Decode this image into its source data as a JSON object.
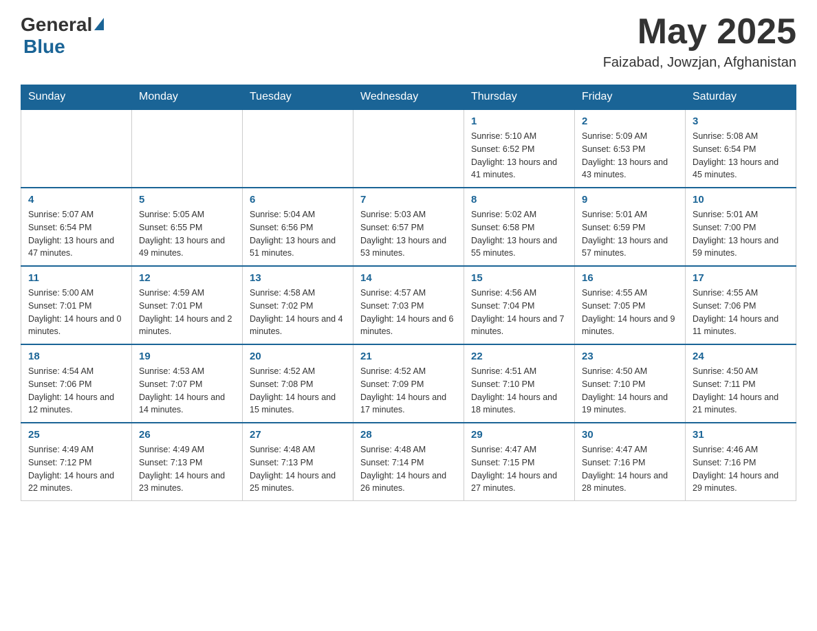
{
  "header": {
    "logo": {
      "general": "General",
      "blue": "Blue"
    },
    "title": "May 2025",
    "location": "Faizabad, Jowzjan, Afghanistan"
  },
  "weekdays": [
    "Sunday",
    "Monday",
    "Tuesday",
    "Wednesday",
    "Thursday",
    "Friday",
    "Saturday"
  ],
  "weeks": [
    [
      {
        "day": "",
        "sunrise": "",
        "sunset": "",
        "daylight": ""
      },
      {
        "day": "",
        "sunrise": "",
        "sunset": "",
        "daylight": ""
      },
      {
        "day": "",
        "sunrise": "",
        "sunset": "",
        "daylight": ""
      },
      {
        "day": "",
        "sunrise": "",
        "sunset": "",
        "daylight": ""
      },
      {
        "day": "1",
        "sunrise": "Sunrise: 5:10 AM",
        "sunset": "Sunset: 6:52 PM",
        "daylight": "Daylight: 13 hours and 41 minutes."
      },
      {
        "day": "2",
        "sunrise": "Sunrise: 5:09 AM",
        "sunset": "Sunset: 6:53 PM",
        "daylight": "Daylight: 13 hours and 43 minutes."
      },
      {
        "day": "3",
        "sunrise": "Sunrise: 5:08 AM",
        "sunset": "Sunset: 6:54 PM",
        "daylight": "Daylight: 13 hours and 45 minutes."
      }
    ],
    [
      {
        "day": "4",
        "sunrise": "Sunrise: 5:07 AM",
        "sunset": "Sunset: 6:54 PM",
        "daylight": "Daylight: 13 hours and 47 minutes."
      },
      {
        "day": "5",
        "sunrise": "Sunrise: 5:05 AM",
        "sunset": "Sunset: 6:55 PM",
        "daylight": "Daylight: 13 hours and 49 minutes."
      },
      {
        "day": "6",
        "sunrise": "Sunrise: 5:04 AM",
        "sunset": "Sunset: 6:56 PM",
        "daylight": "Daylight: 13 hours and 51 minutes."
      },
      {
        "day": "7",
        "sunrise": "Sunrise: 5:03 AM",
        "sunset": "Sunset: 6:57 PM",
        "daylight": "Daylight: 13 hours and 53 minutes."
      },
      {
        "day": "8",
        "sunrise": "Sunrise: 5:02 AM",
        "sunset": "Sunset: 6:58 PM",
        "daylight": "Daylight: 13 hours and 55 minutes."
      },
      {
        "day": "9",
        "sunrise": "Sunrise: 5:01 AM",
        "sunset": "Sunset: 6:59 PM",
        "daylight": "Daylight: 13 hours and 57 minutes."
      },
      {
        "day": "10",
        "sunrise": "Sunrise: 5:01 AM",
        "sunset": "Sunset: 7:00 PM",
        "daylight": "Daylight: 13 hours and 59 minutes."
      }
    ],
    [
      {
        "day": "11",
        "sunrise": "Sunrise: 5:00 AM",
        "sunset": "Sunset: 7:01 PM",
        "daylight": "Daylight: 14 hours and 0 minutes."
      },
      {
        "day": "12",
        "sunrise": "Sunrise: 4:59 AM",
        "sunset": "Sunset: 7:01 PM",
        "daylight": "Daylight: 14 hours and 2 minutes."
      },
      {
        "day": "13",
        "sunrise": "Sunrise: 4:58 AM",
        "sunset": "Sunset: 7:02 PM",
        "daylight": "Daylight: 14 hours and 4 minutes."
      },
      {
        "day": "14",
        "sunrise": "Sunrise: 4:57 AM",
        "sunset": "Sunset: 7:03 PM",
        "daylight": "Daylight: 14 hours and 6 minutes."
      },
      {
        "day": "15",
        "sunrise": "Sunrise: 4:56 AM",
        "sunset": "Sunset: 7:04 PM",
        "daylight": "Daylight: 14 hours and 7 minutes."
      },
      {
        "day": "16",
        "sunrise": "Sunrise: 4:55 AM",
        "sunset": "Sunset: 7:05 PM",
        "daylight": "Daylight: 14 hours and 9 minutes."
      },
      {
        "day": "17",
        "sunrise": "Sunrise: 4:55 AM",
        "sunset": "Sunset: 7:06 PM",
        "daylight": "Daylight: 14 hours and 11 minutes."
      }
    ],
    [
      {
        "day": "18",
        "sunrise": "Sunrise: 4:54 AM",
        "sunset": "Sunset: 7:06 PM",
        "daylight": "Daylight: 14 hours and 12 minutes."
      },
      {
        "day": "19",
        "sunrise": "Sunrise: 4:53 AM",
        "sunset": "Sunset: 7:07 PM",
        "daylight": "Daylight: 14 hours and 14 minutes."
      },
      {
        "day": "20",
        "sunrise": "Sunrise: 4:52 AM",
        "sunset": "Sunset: 7:08 PM",
        "daylight": "Daylight: 14 hours and 15 minutes."
      },
      {
        "day": "21",
        "sunrise": "Sunrise: 4:52 AM",
        "sunset": "Sunset: 7:09 PM",
        "daylight": "Daylight: 14 hours and 17 minutes."
      },
      {
        "day": "22",
        "sunrise": "Sunrise: 4:51 AM",
        "sunset": "Sunset: 7:10 PM",
        "daylight": "Daylight: 14 hours and 18 minutes."
      },
      {
        "day": "23",
        "sunrise": "Sunrise: 4:50 AM",
        "sunset": "Sunset: 7:10 PM",
        "daylight": "Daylight: 14 hours and 19 minutes."
      },
      {
        "day": "24",
        "sunrise": "Sunrise: 4:50 AM",
        "sunset": "Sunset: 7:11 PM",
        "daylight": "Daylight: 14 hours and 21 minutes."
      }
    ],
    [
      {
        "day": "25",
        "sunrise": "Sunrise: 4:49 AM",
        "sunset": "Sunset: 7:12 PM",
        "daylight": "Daylight: 14 hours and 22 minutes."
      },
      {
        "day": "26",
        "sunrise": "Sunrise: 4:49 AM",
        "sunset": "Sunset: 7:13 PM",
        "daylight": "Daylight: 14 hours and 23 minutes."
      },
      {
        "day": "27",
        "sunrise": "Sunrise: 4:48 AM",
        "sunset": "Sunset: 7:13 PM",
        "daylight": "Daylight: 14 hours and 25 minutes."
      },
      {
        "day": "28",
        "sunrise": "Sunrise: 4:48 AM",
        "sunset": "Sunset: 7:14 PM",
        "daylight": "Daylight: 14 hours and 26 minutes."
      },
      {
        "day": "29",
        "sunrise": "Sunrise: 4:47 AM",
        "sunset": "Sunset: 7:15 PM",
        "daylight": "Daylight: 14 hours and 27 minutes."
      },
      {
        "day": "30",
        "sunrise": "Sunrise: 4:47 AM",
        "sunset": "Sunset: 7:16 PM",
        "daylight": "Daylight: 14 hours and 28 minutes."
      },
      {
        "day": "31",
        "sunrise": "Sunrise: 4:46 AM",
        "sunset": "Sunset: 7:16 PM",
        "daylight": "Daylight: 14 hours and 29 minutes."
      }
    ]
  ]
}
